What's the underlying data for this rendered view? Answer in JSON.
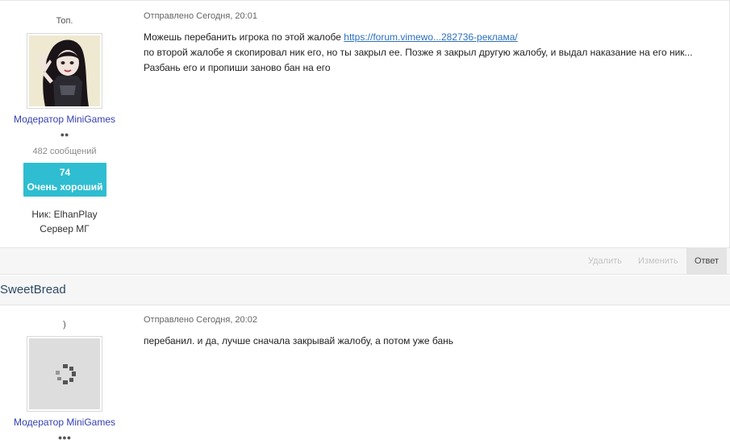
{
  "posts": [
    {
      "user_title": "Топ.",
      "group": "Модератор MiniGames",
      "pips": "●●",
      "post_count": "482 сообщений",
      "reputation": {
        "value": "74",
        "label": "Очень хороший"
      },
      "custom_fields": [
        "Ник: ElhanPlay",
        "Сервер МГ"
      ],
      "date": "Отправлено Сегодня, 20:01",
      "body": {
        "line1_text": "Можешь перебанить игрока по этой жалобе ",
        "line1_link": "https://forum.vimewo...282736-реклама/",
        "line2": "по второй жалобе я скопировал ник его, но ты закрыл ее. Позже я закрыл другую жалобу, и выдал наказание на его ник...",
        "line3": "Разбань его и пропиши заново бан на его"
      }
    },
    {
      "author": "SweetBread",
      "user_title": ")",
      "group": "Модератор MiniGames",
      "pips": "●●●",
      "date": "Отправлено Сегодня, 20:02",
      "body": "перебанил. и да, лучше сначала закрывай жалобу, а потом уже бань"
    }
  ],
  "controls": {
    "delete": "Удалить",
    "edit": "Изменить",
    "reply": "Ответ"
  },
  "colors": {
    "reputation_bg": "#2fbdd1",
    "group_name": "#3340b0",
    "link": "#2c6fbf"
  }
}
